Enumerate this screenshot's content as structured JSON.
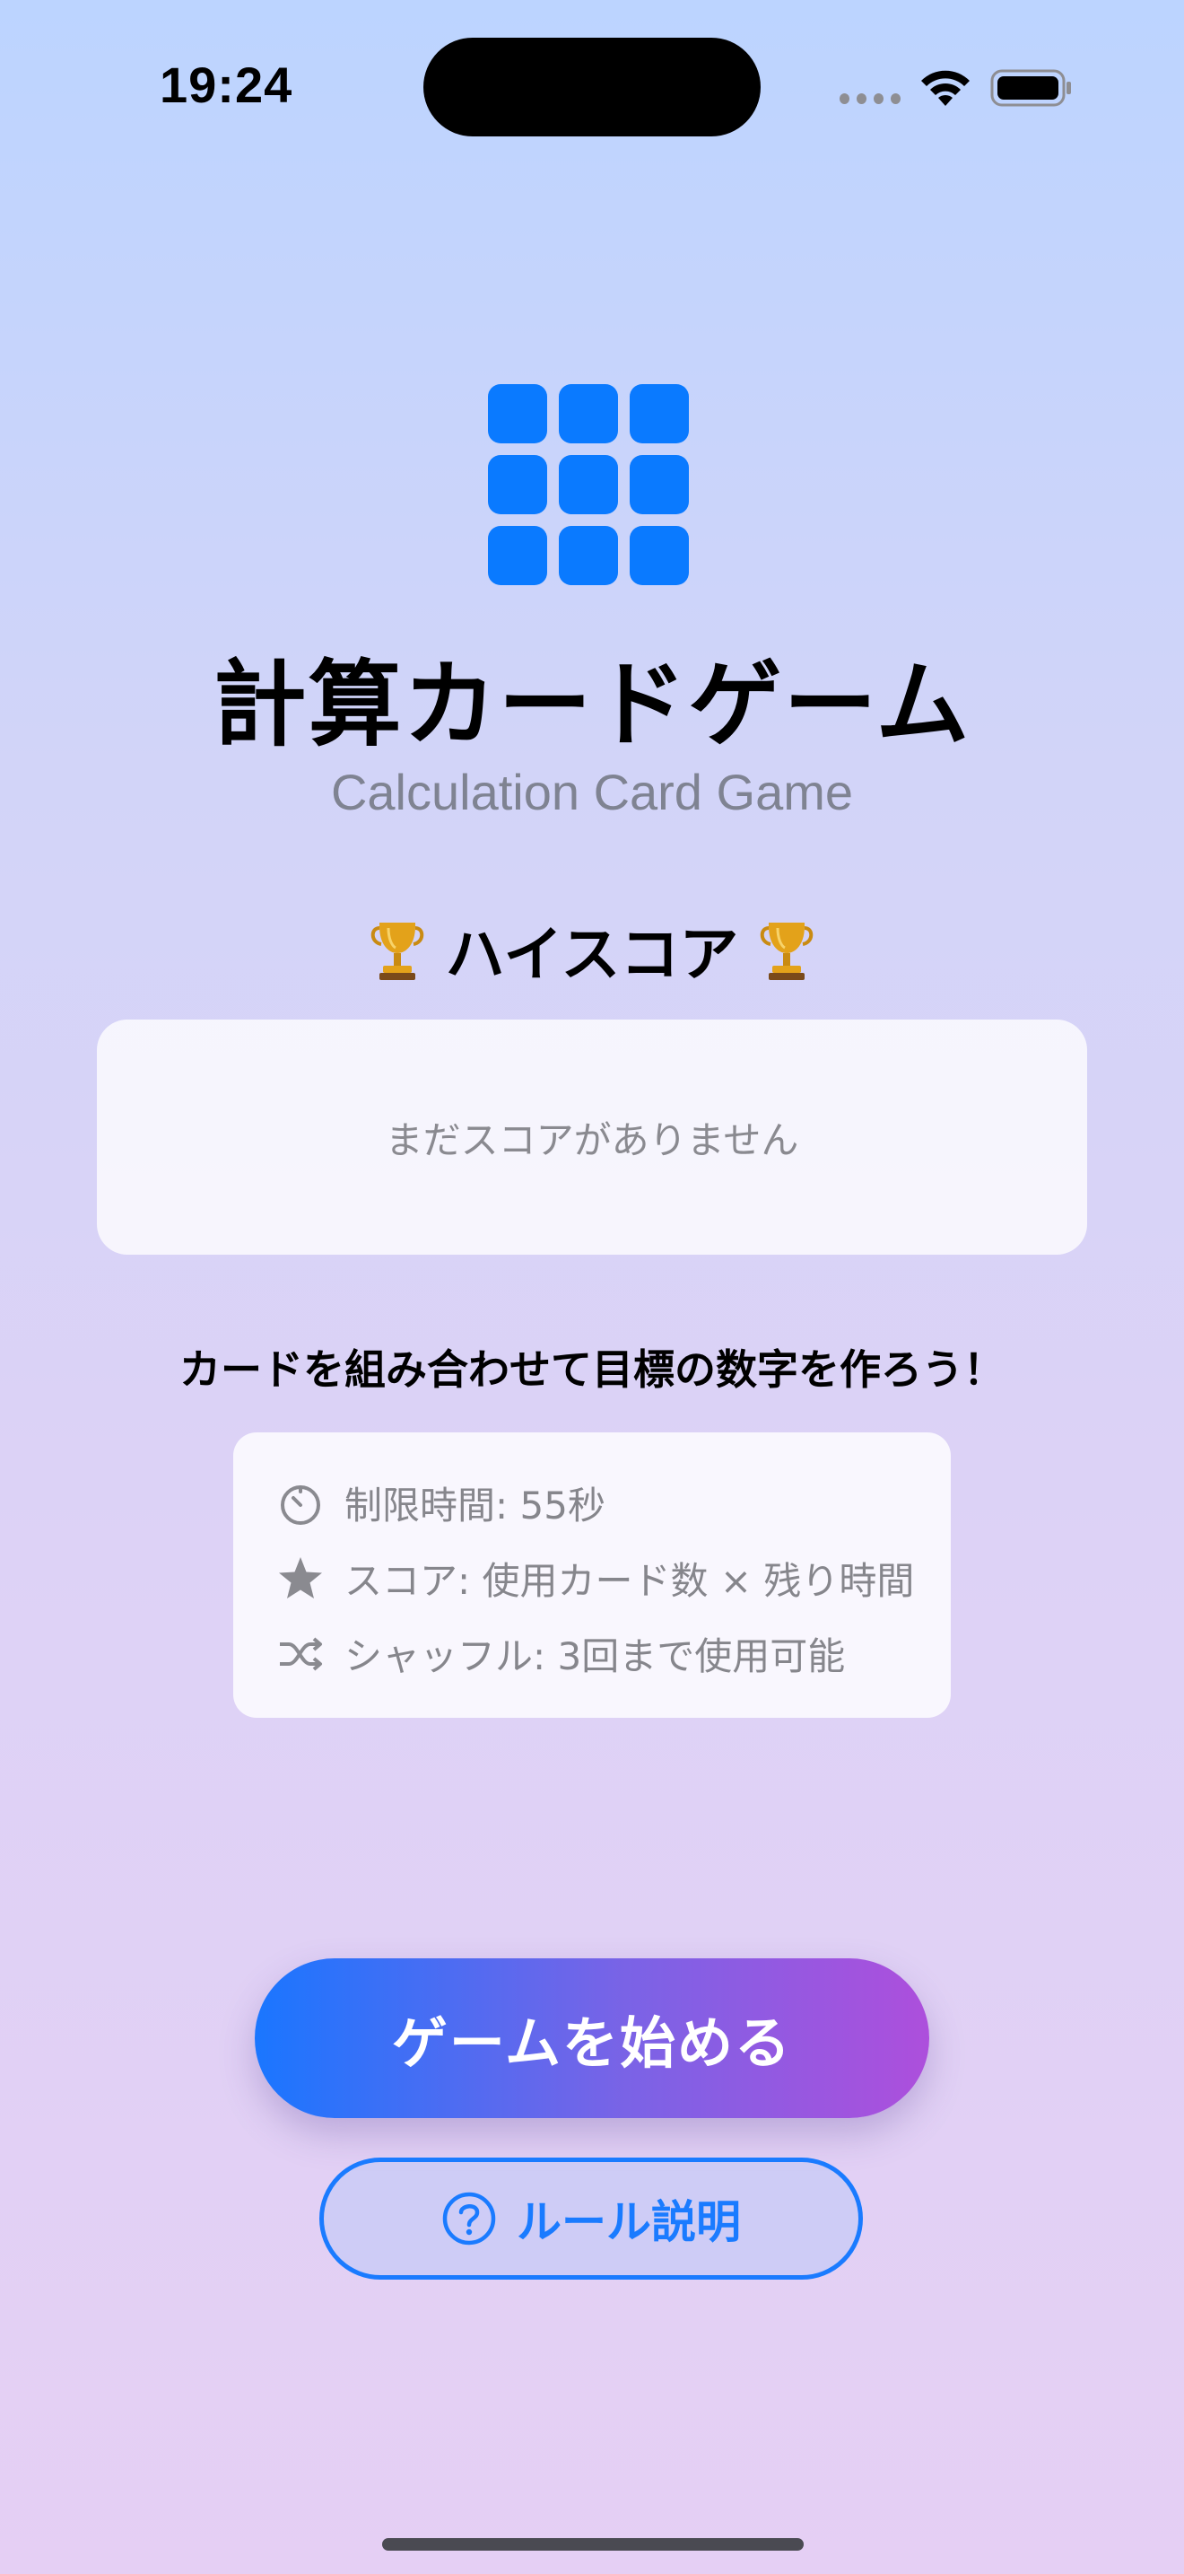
{
  "status_bar": {
    "time": "19:24"
  },
  "app": {
    "title": "計算カードゲーム",
    "subtitle": "Calculation Card Game",
    "icon": "square-grid-3x3-icon",
    "accent_color": "#0a7aff"
  },
  "high_score": {
    "heading": "ハイスコア",
    "icon": "trophy-icon",
    "empty_message": "まだスコアがありません"
  },
  "tagline": "カードを組み合わせて目標の数字を作ろう！",
  "info": {
    "items": [
      {
        "icon": "timer-icon",
        "text": "制限時間: 55秒"
      },
      {
        "icon": "star-icon",
        "text": "スコア: 使用カード数 × 残り時間"
      },
      {
        "icon": "shuffle-icon",
        "text": "シャッフル: 3回まで使用可能"
      }
    ]
  },
  "buttons": {
    "start_label": "ゲームを始める",
    "rules_label": "ルール説明",
    "rules_icon": "question-circle-icon",
    "start_gradient": [
      "#1a76ff",
      "#ad4fdc"
    ]
  }
}
